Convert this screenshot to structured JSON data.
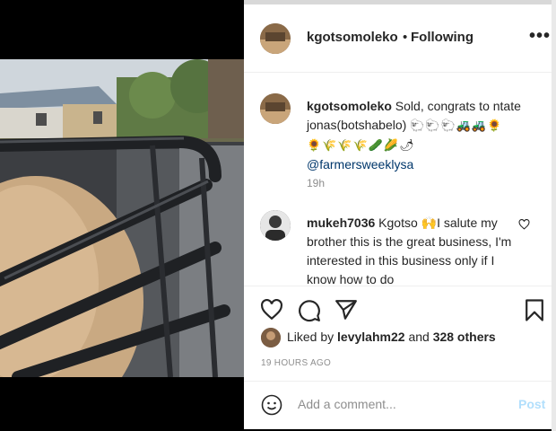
{
  "post": {
    "username": "kgotsomoleko",
    "separator": "•",
    "follow_status": "Following",
    "more_label": "•••"
  },
  "caption": {
    "username": "kgotsomoleko",
    "text": "Sold, congrats to ntate jonas(botshabelo)",
    "emojis_line1": "🐑🐑🐑🚜🚜🌻",
    "emojis_line2": "🌻🌾🌾🌾🥒🌽🌶",
    "mention": "@farmersweeklysa",
    "age": "19h"
  },
  "comment": {
    "username": "mukeh7036",
    "text_before": "Kgotso",
    "emoji": "🙌",
    "text_after": "I salute my brother this is the great business, I'm interested in this business only if I know how to do"
  },
  "likes": {
    "prefix": "Liked by",
    "user": "levylahm22",
    "connector": "and",
    "others": "328 others"
  },
  "timestamp": "19 HOURS AGO",
  "add_comment": {
    "placeholder": "Add a comment...",
    "post_label": "Post"
  },
  "colors": {
    "link": "#00376b",
    "post_disabled": "#b2dffc",
    "secondary_text": "#8e8e8e"
  }
}
